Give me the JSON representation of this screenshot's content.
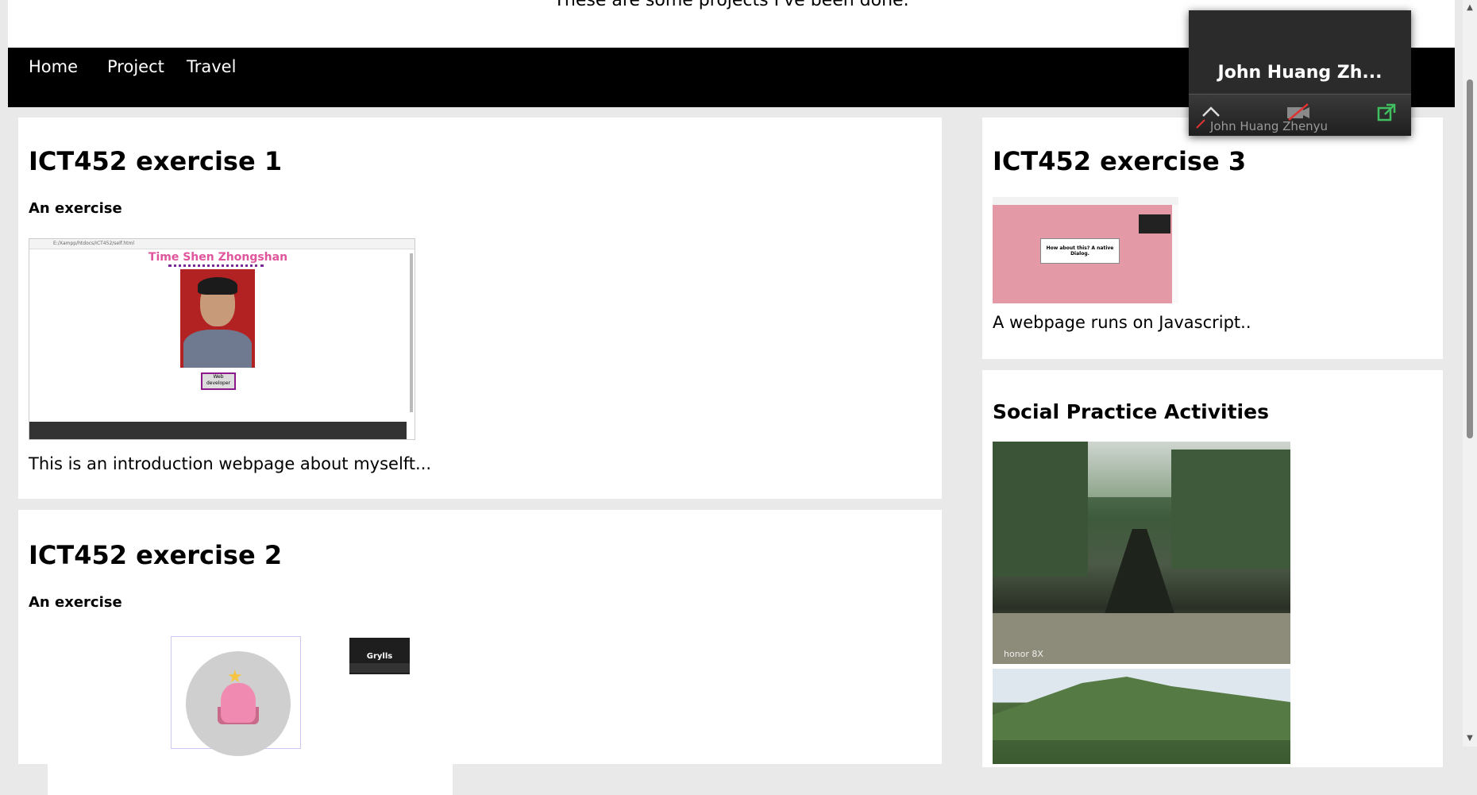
{
  "header": {
    "tagline": "These are some projects I've been done."
  },
  "nav": {
    "items": [
      {
        "label": "Home"
      },
      {
        "label": "Project"
      },
      {
        "label": "Travel"
      }
    ]
  },
  "main": {
    "cards": [
      {
        "title": "ICT452 exercise 1",
        "subtitle": "An exercise",
        "description": "This is an introduction webpage about myselft...",
        "thumbnail": {
          "page_title": "Time Shen Zhongshan",
          "button_label": "Web developer"
        }
      },
      {
        "title": "ICT452 exercise 2",
        "subtitle": "An exercise",
        "thumbnail": {
          "zoom_name": "Grylls"
        }
      }
    ]
  },
  "side": {
    "card3": {
      "title": "ICT452 exercise 3",
      "description": "A webpage runs on Javascript..",
      "thumbnail": {
        "dialog_text": "How about this? A native Dialog."
      }
    },
    "social": {
      "title": "Social Practice Activities",
      "photo_watermark": "honor 8X"
    }
  },
  "zoom_window": {
    "display_name": "John Huang Zh...",
    "full_name": "John Huang Zhenyu"
  },
  "colors": {
    "navbar": "#000000",
    "page_bg": "#e9e9e9",
    "card_bg": "#ffffff",
    "zoom_bg": "#2b2b2b"
  }
}
